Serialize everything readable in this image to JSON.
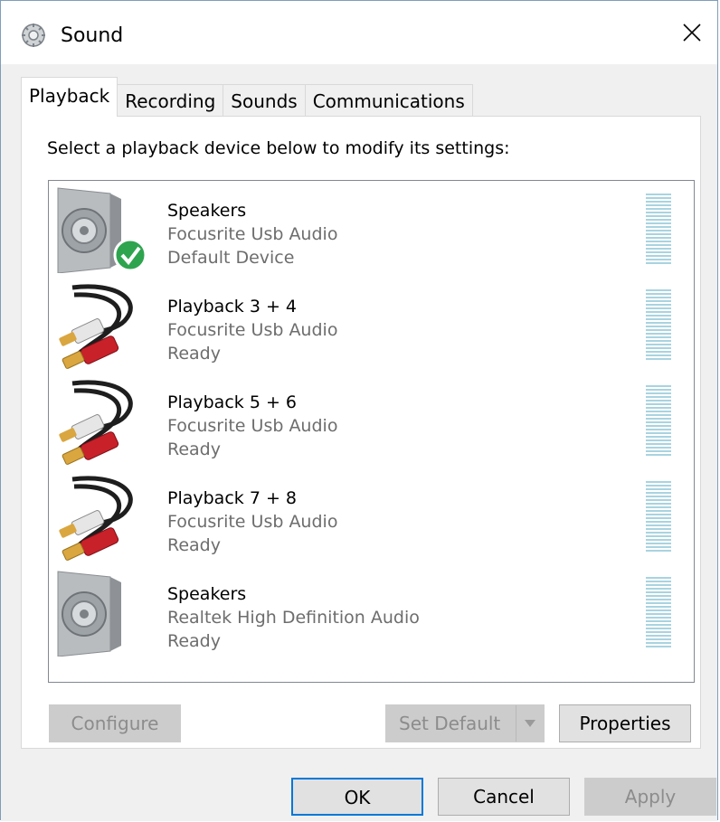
{
  "window": {
    "title": "Sound",
    "title_icon": "speaker-gear-icon"
  },
  "tabs": [
    {
      "label": "Playback",
      "active": true
    },
    {
      "label": "Recording",
      "active": false
    },
    {
      "label": "Sounds",
      "active": false
    },
    {
      "label": "Communications",
      "active": false
    }
  ],
  "playback": {
    "instructions": "Select a playback device below to modify its settings:",
    "devices": [
      {
        "name": "Speakers",
        "description": "Focusrite Usb Audio",
        "status": "Default Device",
        "icon": "speaker-icon",
        "default": true
      },
      {
        "name": "Playback 3 + 4",
        "description": "Focusrite Usb Audio",
        "status": "Ready",
        "icon": "rca-cable-icon",
        "default": false
      },
      {
        "name": "Playback 5 + 6",
        "description": "Focusrite Usb Audio",
        "status": "Ready",
        "icon": "rca-cable-icon",
        "default": false
      },
      {
        "name": "Playback 7 + 8",
        "description": "Focusrite Usb Audio",
        "status": "Ready",
        "icon": "rca-cable-icon",
        "default": false
      },
      {
        "name": "Speakers",
        "description": "Realtek High Definition Audio",
        "status": "Ready",
        "icon": "speaker-icon",
        "default": false
      }
    ],
    "buttons": {
      "configure": "Configure",
      "set_default": "Set Default",
      "properties": "Properties"
    }
  },
  "dialog_buttons": {
    "ok": "OK",
    "cancel": "Cancel",
    "apply": "Apply"
  },
  "colors": {
    "accent": "#0078d7",
    "meter": "#a9d3e0",
    "check": "#2ea44f"
  }
}
